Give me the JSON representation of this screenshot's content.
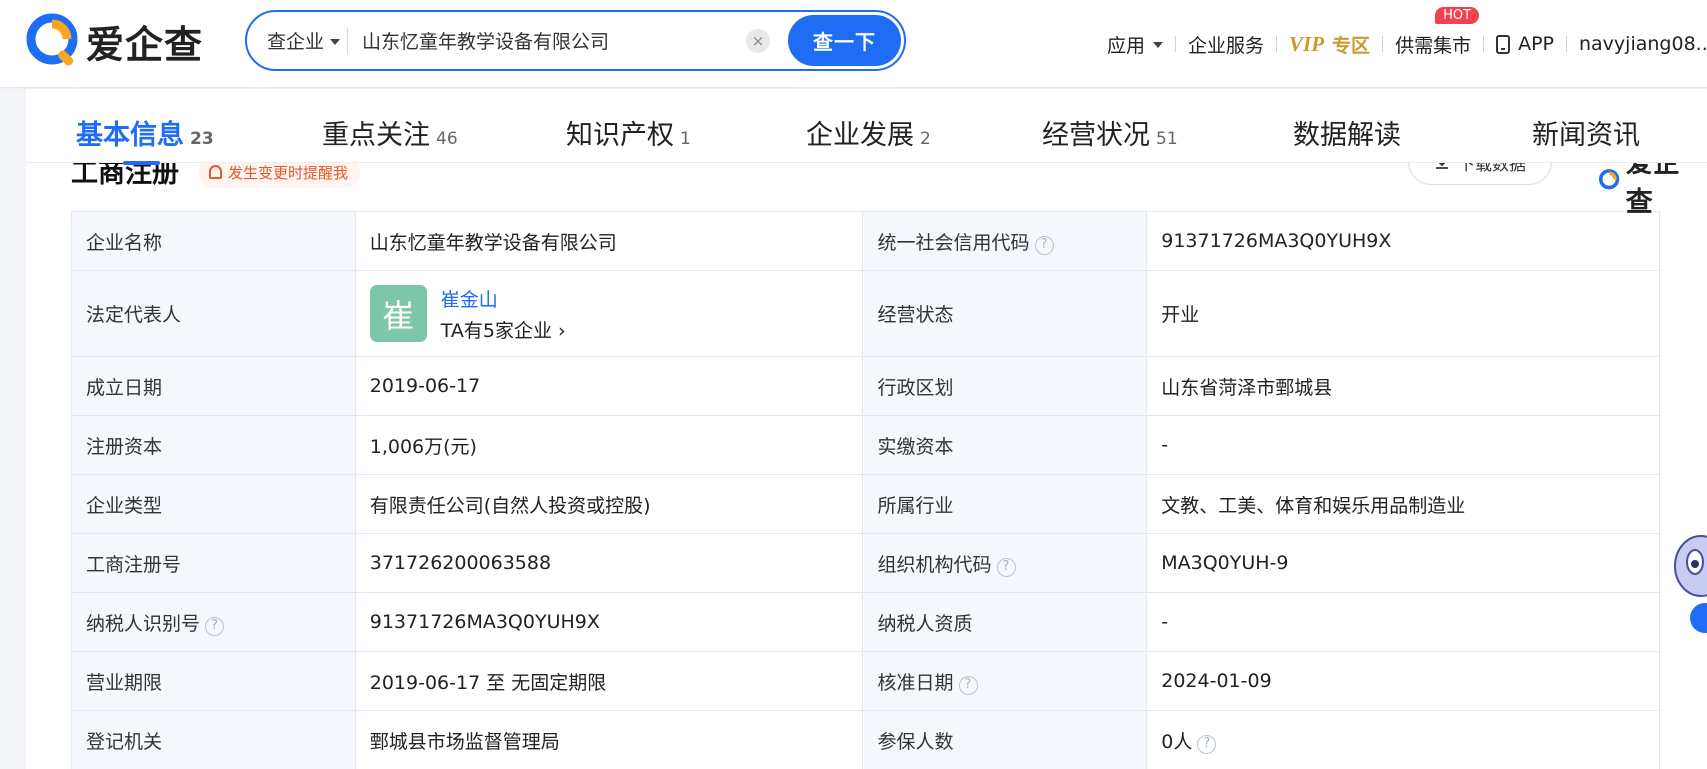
{
  "header": {
    "logo_text": "爱企查",
    "search": {
      "type_label": "查企业",
      "value": "山东忆童年教学设备有限公司",
      "clear_symbol": "×",
      "button_label": "查一下"
    },
    "nav": {
      "apps": "应用",
      "enterprise_services": "企业服务",
      "vip_mark": "VIP",
      "vip_label": "专区",
      "market": "供需集市",
      "hot_badge": "HOT",
      "app": "APP",
      "user": "navyjiang08..."
    }
  },
  "tabs": [
    {
      "label": "基本信息",
      "count": "23"
    },
    {
      "label": "重点关注",
      "count": "46"
    },
    {
      "label": "知识产权",
      "count": "1"
    },
    {
      "label": "企业发展",
      "count": "2"
    },
    {
      "label": "经营状况",
      "count": "51"
    },
    {
      "label": "数据解读",
      "count": ""
    },
    {
      "label": "新闻资讯",
      "count": ""
    }
  ],
  "section": {
    "title": "工商注册",
    "remind_label": "发生变更时提醒我",
    "download_label": "下载数据",
    "watermark": "爱企查"
  },
  "registration": {
    "company_name_label": "企业名称",
    "company_name": "山东忆童年教学设备有限公司",
    "credit_code_label": "统一社会信用代码",
    "credit_code": "91371726MA3Q0YUH9X",
    "legal_rep_label": "法定代表人",
    "legal_rep_avatar": "崔",
    "legal_rep_name": "崔金山",
    "legal_rep_companies": "TA有5家企业",
    "status_label": "经营状态",
    "status": "开业",
    "founded_label": "成立日期",
    "founded": "2019-06-17",
    "region_label": "行政区划",
    "region": "山东省菏泽市鄄城县",
    "capital_label": "注册资本",
    "capital": "1,006万(元)",
    "paid_capital_label": "实缴资本",
    "paid_capital": "-",
    "type_label": "企业类型",
    "type": "有限责任公司(自然人投资或控股)",
    "industry_label": "所属行业",
    "industry": "文教、工美、体育和娱乐用品制造业",
    "reg_no_label": "工商注册号",
    "reg_no": "371726200063588",
    "org_code_label": "组织机构代码",
    "org_code": "MA3Q0YUH-9",
    "taxpayer_id_label": "纳税人识别号",
    "taxpayer_id": "91371726MA3Q0YUH9X",
    "taxpayer_qual_label": "纳税人资质",
    "taxpayer_qual": "-",
    "term_label": "营业期限",
    "term": "2019-06-17 至 无固定期限",
    "approval_date_label": "核准日期",
    "approval_date": "2024-01-09",
    "authority_label": "登记机关",
    "authority": "鄄城县市场监督管理局",
    "insured_label": "参保人数",
    "insured": "0人"
  },
  "colors": {
    "brand": "#1f6cf5",
    "vip": "#c99a2e",
    "hot": "#f0434e",
    "remind": "#e05b2b",
    "avatar_bg": "#7dc6a9"
  }
}
